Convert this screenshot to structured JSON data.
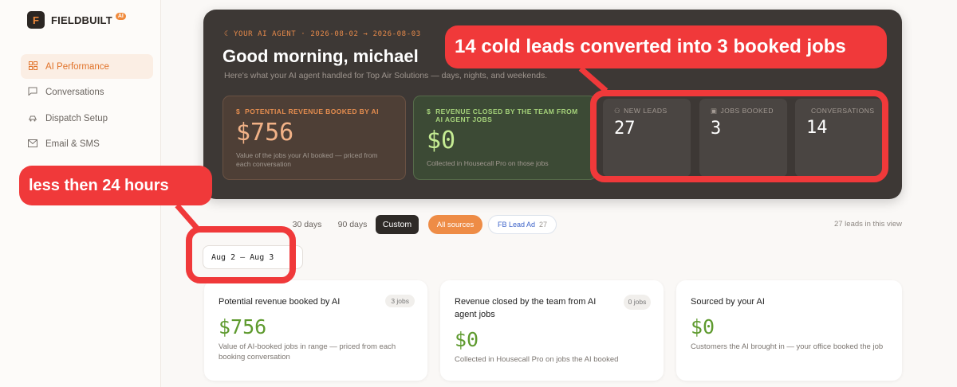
{
  "sidebar": {
    "logo_letter": "F",
    "brand": "FIELDBUILT",
    "brand_badge": "AI",
    "items": [
      {
        "label": "AI Performance",
        "icon": "grid-icon",
        "active": true
      },
      {
        "label": "Conversations",
        "icon": "chat-icon"
      },
      {
        "label": "Dispatch Setup",
        "icon": "truck-icon"
      },
      {
        "label": "Email & SMS",
        "icon": "mail-icon"
      }
    ]
  },
  "hero": {
    "meta": "YOUR AI AGENT · 2026-08-02 → 2026-08-03",
    "title": "Good morning, michael",
    "subtitle": "Here's what your AI agent handled for Top Air Solutions — days, nights, and weekends.",
    "revenue_ai": {
      "label": "POTENTIAL REVENUE BOOKED BY AI",
      "value": "$756",
      "note": "Value of the jobs your AI booked — priced from each conversation"
    },
    "revenue_team": {
      "label": "REVENUE CLOSED BY THE TEAM FROM AI AGENT JOBS",
      "value": "$0",
      "note": "Collected in Housecall Pro on those jobs"
    },
    "new_leads": {
      "label": "NEW LEADS",
      "value": "27"
    },
    "jobs_booked": {
      "label": "JOBS BOOKED",
      "value": "3"
    },
    "conversations": {
      "label": "CONVERSATIONS",
      "value": "14"
    }
  },
  "annotations": {
    "top": "14 cold leads converted into 3 booked jobs",
    "left": "less then 24 hours"
  },
  "filters": {
    "range_30": "30 days",
    "range_90": "90 days",
    "custom": "Custom",
    "all_sources": "All sources",
    "source": "FB Lead Ad",
    "source_count": "27",
    "leads_in_view": "27 leads in this view",
    "date_range": "Aug 2 – Aug 3"
  },
  "cards": [
    {
      "title": "Potential revenue booked by AI",
      "badge": "3 jobs",
      "value": "$756",
      "note": "Value of AI-booked jobs in range — priced from each booking conversation"
    },
    {
      "title": "Revenue closed by the team from AI agent jobs",
      "badge": "0 jobs",
      "value": "$0",
      "note": "Collected in Housecall Pro on jobs the AI booked"
    },
    {
      "title": "Sourced by your AI",
      "value": "$0",
      "note": "Customers the AI brought in — your office booked the job"
    }
  ],
  "colors": {
    "accent": "#ee8c46",
    "hero_bg": "#3d3835",
    "annotation_red": "#f0393a",
    "money_green": "#5e9a2e"
  }
}
